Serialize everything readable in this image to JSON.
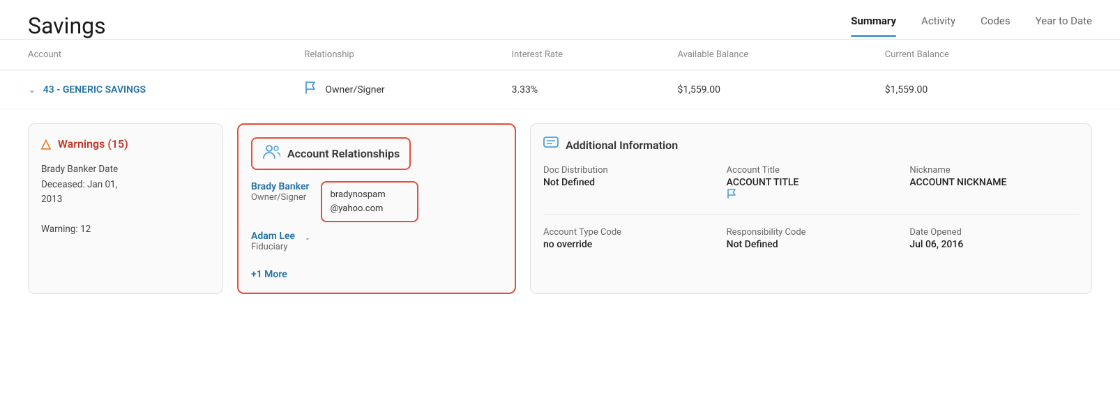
{
  "header": {
    "title": "Savings",
    "tabs": [
      {
        "id": "summary",
        "label": "Summary",
        "active": true
      },
      {
        "id": "activity",
        "label": "Activity",
        "active": false
      },
      {
        "id": "codes",
        "label": "Codes",
        "active": false
      },
      {
        "id": "year-to-date",
        "label": "Year to Date",
        "active": false
      }
    ]
  },
  "table": {
    "columns": [
      "Account",
      "Relationship",
      "Interest Rate",
      "Available Balance",
      "Current Balance"
    ],
    "row": {
      "account_number": "43 - GENERIC SAVINGS",
      "relationship": "Owner/Signer",
      "interest_rate": "3.33%",
      "available_balance": "$1,559.00",
      "current_balance": "$1,559.00"
    }
  },
  "cards": {
    "warnings": {
      "title": "Warnings (15)",
      "content_line1": "Brady Banker Date",
      "content_line2": "Deceased: Jan 01,",
      "content_line3": "2013",
      "content_line4": "",
      "content_line5": "Warning: 12"
    },
    "relationships": {
      "title": "Account Relationships",
      "people": [
        {
          "name": "Brady Banker",
          "role": "Owner/Signer",
          "email": "bradynospam@yahoo.com"
        },
        {
          "name": "Adam Lee",
          "role": "Fiduciary",
          "email": "-"
        }
      ],
      "more_label": "+1 More"
    },
    "additional_info": {
      "title": "Additional Information",
      "fields": [
        {
          "label": "Doc Distribution",
          "value": "Not Defined"
        },
        {
          "label": "Account Title",
          "value": "ACCOUNT TITLE"
        },
        {
          "label": "Nickname",
          "value": "ACCOUNT NICKNAME"
        },
        {
          "label": "Account Type Code",
          "value": "no override"
        },
        {
          "label": "Responsibility Code",
          "value": "Not Defined"
        },
        {
          "label": "Date Opened",
          "value": "Jul 06, 2016"
        }
      ]
    }
  }
}
